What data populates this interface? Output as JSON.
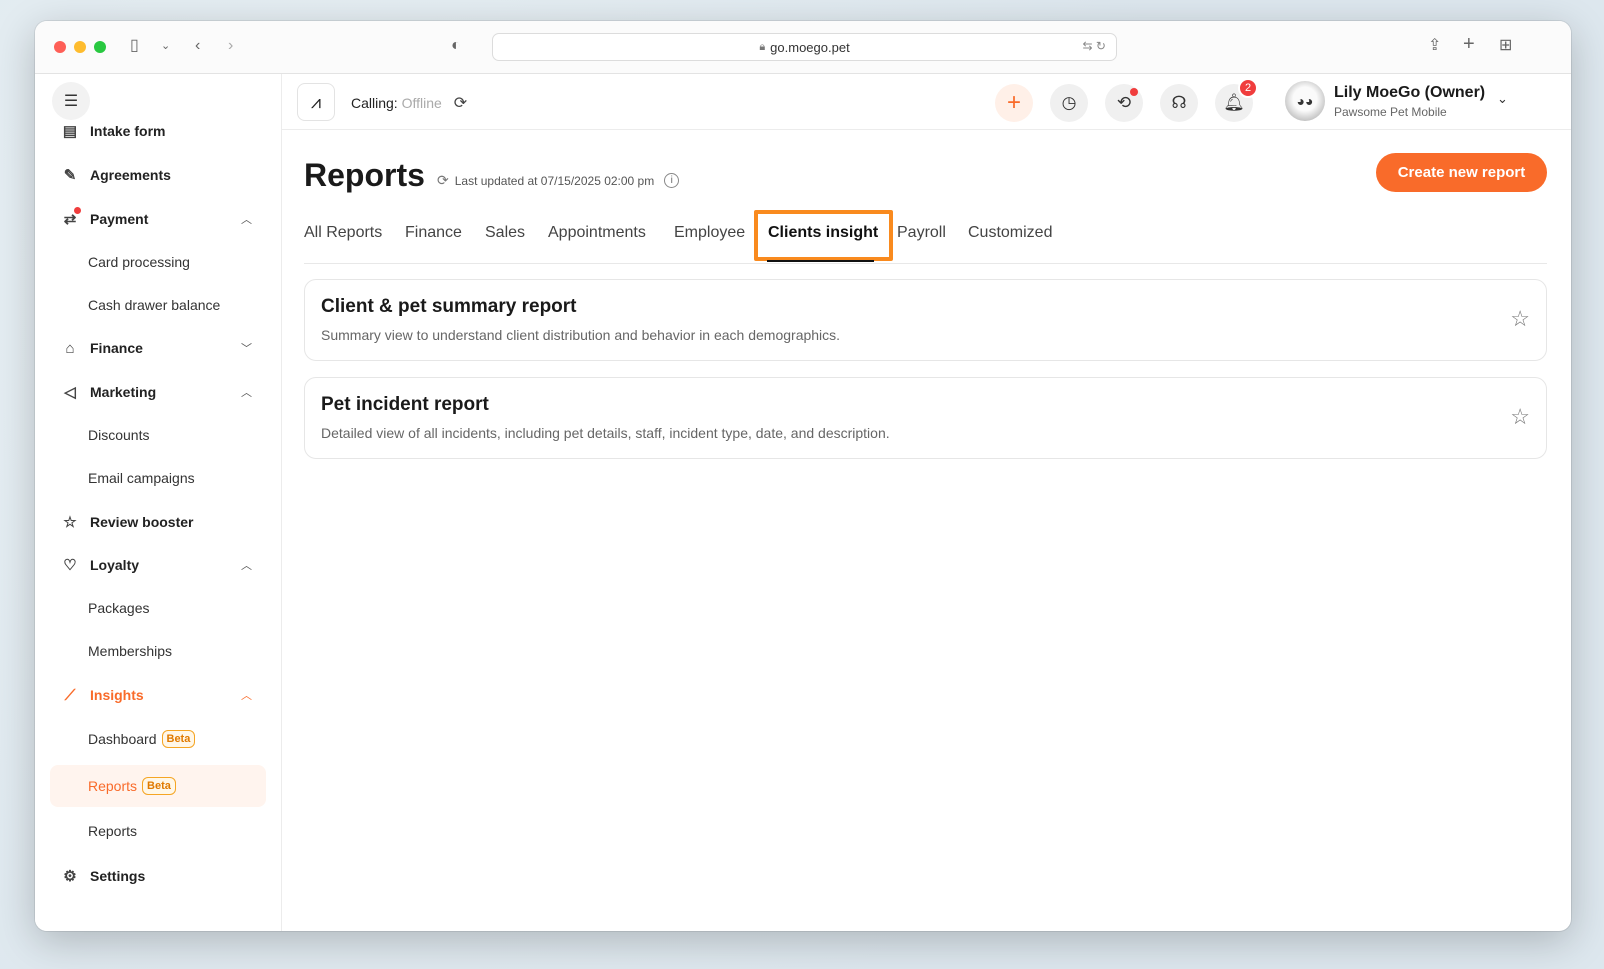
{
  "browser": {
    "url": "go.moego.pet"
  },
  "sidebar": {
    "items": [
      {
        "label": "Intake form"
      },
      {
        "label": "Agreements"
      },
      {
        "label": "Payment"
      },
      {
        "label": "Card processing"
      },
      {
        "label": "Cash drawer balance"
      },
      {
        "label": "Finance"
      },
      {
        "label": "Marketing"
      },
      {
        "label": "Discounts"
      },
      {
        "label": "Email campaigns"
      },
      {
        "label": "Review booster"
      },
      {
        "label": "Loyalty"
      },
      {
        "label": "Packages"
      },
      {
        "label": "Memberships"
      },
      {
        "label": "Insights"
      },
      {
        "label": "Dashboard",
        "badge": "Beta"
      },
      {
        "label": "Reports",
        "badge": "Beta"
      },
      {
        "label": "Reports"
      },
      {
        "label": "Settings"
      }
    ]
  },
  "topbar": {
    "calling_label": "Calling:",
    "calling_status": "Offline",
    "notification_count": "2",
    "user_name": "Lily MoeGo (Owner)",
    "business_name": "Pawsome Pet Mobile"
  },
  "main": {
    "title": "Reports",
    "last_updated": "Last updated at 07/15/2025 02:00 pm",
    "create_button": "Create new report",
    "tabs": [
      {
        "label": "All Reports"
      },
      {
        "label": "Finance"
      },
      {
        "label": "Sales"
      },
      {
        "label": "Appointments"
      },
      {
        "label": "Employee"
      },
      {
        "label": "Clients insight"
      },
      {
        "label": "Payroll"
      },
      {
        "label": "Customized"
      }
    ],
    "active_tab": "Clients insight",
    "cards": [
      {
        "title": "Client & pet summary report",
        "description": "Summary view to understand client distribution and behavior in each demographics."
      },
      {
        "title": "Pet incident report",
        "description": "Detailed view of all incidents, including pet details, staff, incident type, date, and description."
      }
    ]
  },
  "colors": {
    "accent": "#f96b2a",
    "highlight_box": "#f98a1e",
    "badge_red": "#f03d3d"
  }
}
